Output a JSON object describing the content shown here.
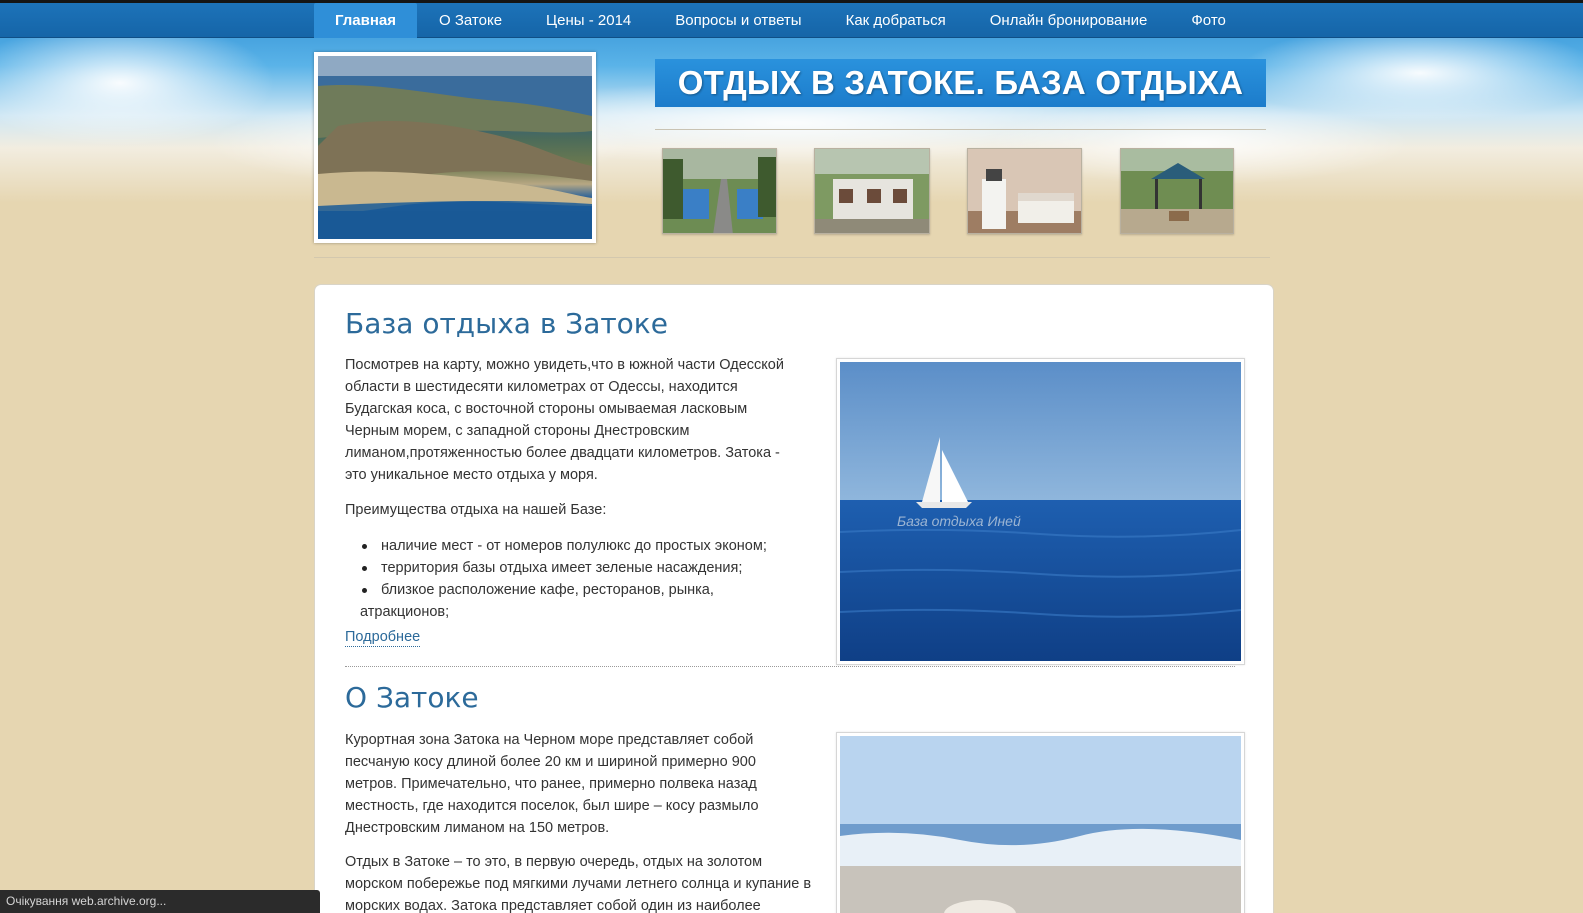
{
  "nav": {
    "items": [
      {
        "label": "Главная",
        "active": true
      },
      {
        "label": "О Затоке",
        "active": false
      },
      {
        "label": "Цены - 2014",
        "active": false
      },
      {
        "label": "Вопросы и ответы",
        "active": false
      },
      {
        "label": "Как добраться",
        "active": false
      },
      {
        "label": "Онлайн бронирование",
        "active": false
      },
      {
        "label": "Фото",
        "active": false
      }
    ]
  },
  "header": {
    "site_title": "ОТДЫХ В ЗАТОКЕ. БАЗА ОТДЫХА"
  },
  "section1": {
    "title": "База отдыха в Затоке",
    "paragraph": "Посмотрев на карту, можно увидеть,что в южной части Одесской области в шестидесяти километрах от Одессы, находится Будагская коса, с восточной стороны омываемая ласковым Черным морем, с западной стороны Днестровским лиманом,протяженностью более двадцати километров. Затока - это уникальное место отдыха у моря.",
    "benefits_intro": "Преимущества отдыха на нашей Базе:",
    "benefits": [
      "наличие мест - от номеров полулюкс до простых эконом;",
      "территория базы отдыха имеет зеленые насаждения;",
      "близкое расположение кафе, ресторанов, рынка,"
    ],
    "benefits_continuation": "атракционов;",
    "more_link": "Подробнее",
    "image_caption": "База отдыха  Иней"
  },
  "section2": {
    "title": "О Затоке",
    "paragraph1": "Курортная зона Затока на Черном море представляет собой песчаную косу длиной более 20 км и шириной примерно 900 метров. Примечательно, что ранее, примерно полвека назад местность, где находится поселок, был шире – косу размыло Днестровским лиманом на 150 метров.",
    "paragraph2": "Отдых в Затоке – то это, в первую очередь, отдых на золотом морском побережье под мягкими лучами летнего солнца и купание в морских водах. Затока представляет собой один из наиболее"
  },
  "statusbar": {
    "text": "Очікування web.archive.org..."
  },
  "colors": {
    "nav_bg": "#1d73b9",
    "nav_active": "#2f8fd8",
    "title_bg": "#2a92dd",
    "heading": "#2c6a9a",
    "sand": "#e6d6b1"
  }
}
